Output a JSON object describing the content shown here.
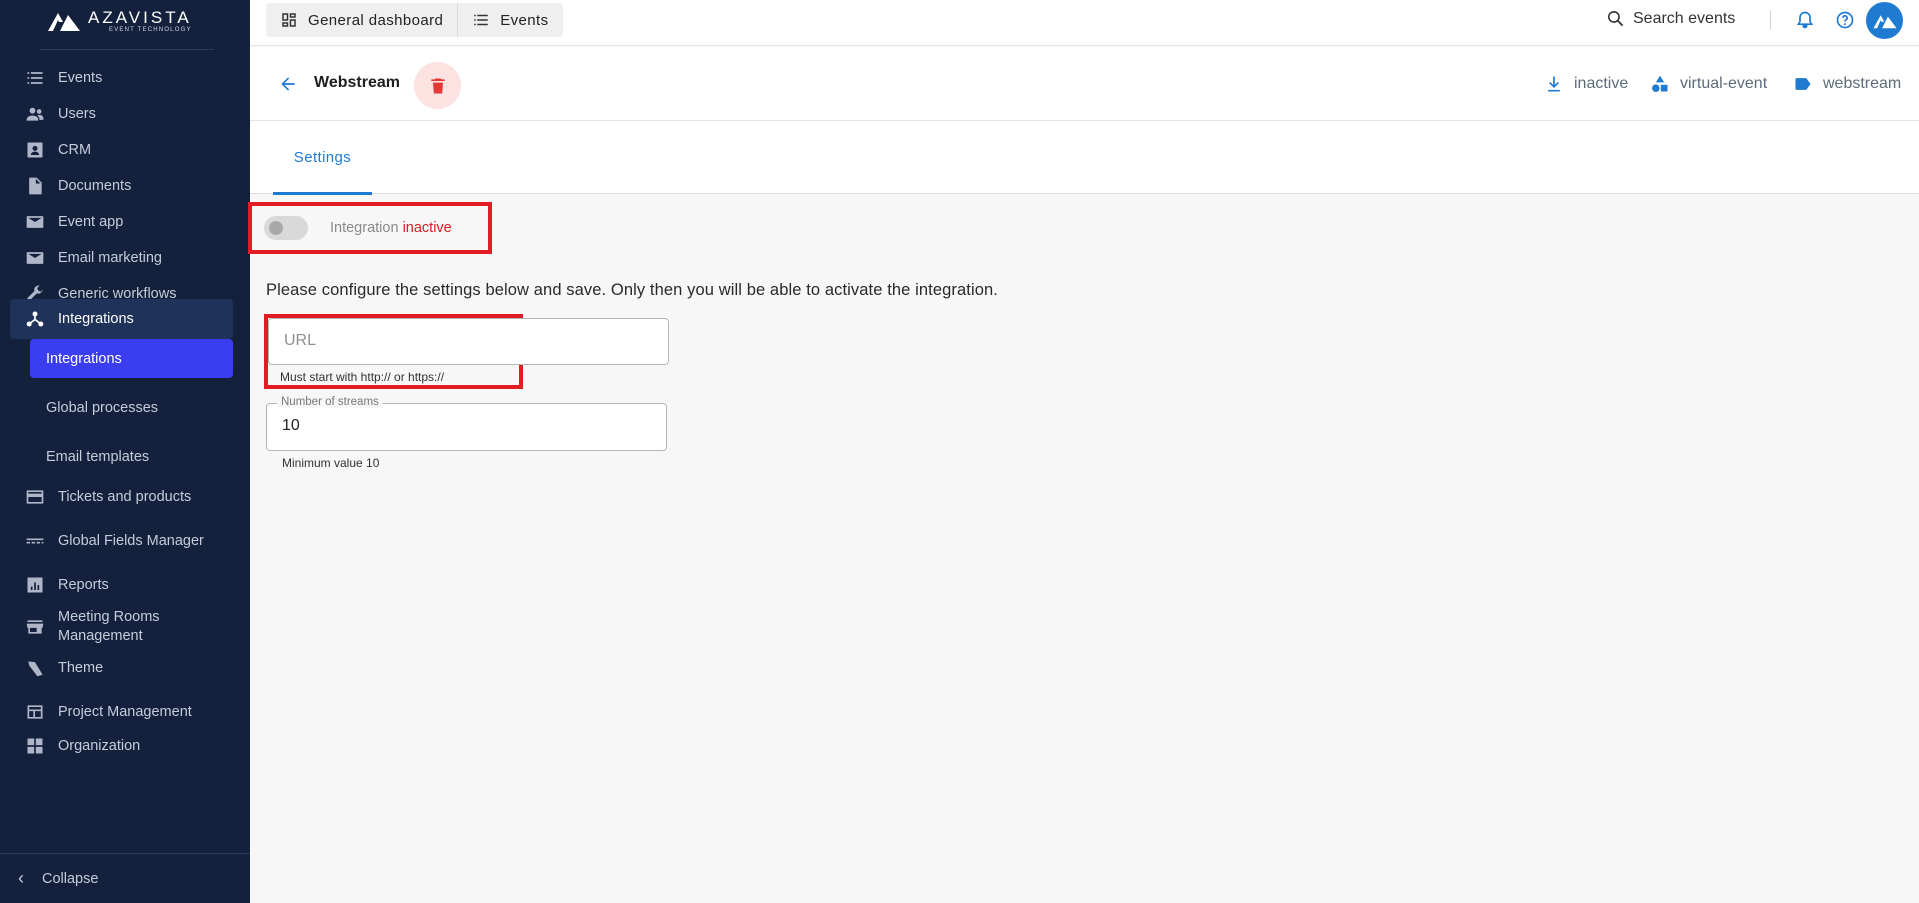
{
  "brand": {
    "name": "AZAVISTA",
    "tagline": "EVENT TECHNOLOGY"
  },
  "sidebar": {
    "items": [
      {
        "label": "Events",
        "icon": "list-icon"
      },
      {
        "label": "Users",
        "icon": "users-icon"
      },
      {
        "label": "CRM",
        "icon": "contact-card-icon"
      },
      {
        "label": "Documents",
        "icon": "document-icon"
      },
      {
        "label": "Event app",
        "icon": "mail-icon"
      },
      {
        "label": "Email marketing",
        "icon": "mail-icon"
      },
      {
        "label": "Generic workflows",
        "icon": "wrench-icon"
      },
      {
        "label": "Integrations",
        "icon": "integrations-icon"
      },
      {
        "label": "Tickets and products",
        "icon": "credit-card-icon"
      },
      {
        "label": "Global Fields Manager",
        "icon": "fields-icon"
      },
      {
        "label": "Reports",
        "icon": "bar-chart-icon"
      },
      {
        "label": "Meeting Rooms Management",
        "icon": "store-icon"
      },
      {
        "label": "Theme",
        "icon": "theme-icon"
      },
      {
        "label": "Project Management",
        "icon": "board-icon"
      },
      {
        "label": "Organization",
        "icon": "grid-icon"
      }
    ],
    "subitems": [
      {
        "label": "Integrations"
      },
      {
        "label": "Global processes"
      },
      {
        "label": "Email templates"
      }
    ],
    "collapse_label": "Collapse"
  },
  "topbar": {
    "tabs": [
      {
        "label": "General dashboard",
        "icon": "dashboard-icon"
      },
      {
        "label": "Events",
        "icon": "list-icon"
      }
    ],
    "search_label": "Search events"
  },
  "header": {
    "title": "Webstream",
    "meta": [
      {
        "label": "inactive",
        "icon": "download-icon"
      },
      {
        "label": "virtual-event",
        "icon": "shapes-icon"
      },
      {
        "label": "webstream",
        "icon": "label-icon"
      }
    ]
  },
  "tabs": [
    {
      "label": "Settings"
    }
  ],
  "integration": {
    "prefix": "Integration",
    "status": "inactive"
  },
  "info_text": "Please configure the settings below and save. Only then you will be able to activate the integration.",
  "fields": {
    "url": {
      "placeholder": "URL",
      "helper": "Must start with http:// or https://"
    },
    "streams": {
      "label": "Number of streams",
      "value": "10",
      "helper": "Minimum value 10"
    }
  },
  "colors": {
    "sidebar_bg": "#14213d",
    "accent": "#1f7ad1",
    "active_sub": "#3b3df0",
    "danger": "#e31b23"
  }
}
